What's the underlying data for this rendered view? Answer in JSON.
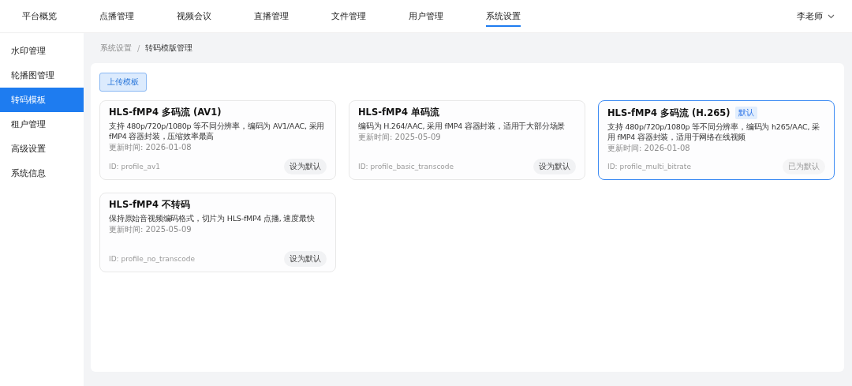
{
  "nav": {
    "items": [
      {
        "label": "平台概览",
        "selected": false
      },
      {
        "label": "点播管理",
        "selected": false
      },
      {
        "label": "视频会议",
        "selected": false
      },
      {
        "label": "直播管理",
        "selected": false
      },
      {
        "label": "文件管理",
        "selected": false
      },
      {
        "label": "用户管理",
        "selected": false
      },
      {
        "label": "系统设置",
        "selected": true
      }
    ],
    "user": "李老师"
  },
  "sidebar": {
    "items": [
      {
        "label": "水印管理",
        "selected": false
      },
      {
        "label": "轮播图管理",
        "selected": false
      },
      {
        "label": "转码模板",
        "selected": true
      },
      {
        "label": "租户管理",
        "selected": false
      },
      {
        "label": "高级设置",
        "selected": false
      },
      {
        "label": "系统信息",
        "selected": false
      }
    ]
  },
  "breadcrumb": [
    "系统设置",
    "转码模版管理"
  ],
  "breadcrumb_separator": "/",
  "upload_button": "上传模板",
  "templates": [
    {
      "title": "HLS-fMP4 多码流 (AV1)",
      "description": "支持 480p/720p/1080p 等不同分辨率，编码为 AV1/AAC, 采用 fMP4 容器封装，压缩效率最高",
      "updated": "更新时间: 2026-01-08",
      "id": "ID: profile_av1",
      "is_default": false,
      "button": "设为默认"
    },
    {
      "title": "HLS-fMP4 单码流",
      "description": "编码为 H.264/AAC, 采用 fMP4 容器封装，适用于大部分场景",
      "updated": "更新时间: 2025-05-09",
      "id": "ID: profile_basic_transcode",
      "is_default": false,
      "button": "设为默认"
    },
    {
      "title": "HLS-fMP4 多码流 (H.265)",
      "badge": "默认",
      "description": "支持 480p/720p/1080p 等不同分辨率，编码为 h265/AAC, 采用 fMP4 容器封装，适用于网络在线视频",
      "updated": "更新时间: 2026-01-08",
      "id": "ID: profile_multi_bitrate",
      "is_default": true,
      "button": "已为默认"
    },
    {
      "title": "HLS-fMP4 不转码",
      "description": "保持原始音视频编码格式，切片为 HLS-fMP4 点播, 速度最快",
      "updated": "更新时间: 2025-05-09",
      "id": "ID: profile_no_transcode",
      "is_default": false,
      "button": "设为默认"
    }
  ]
}
